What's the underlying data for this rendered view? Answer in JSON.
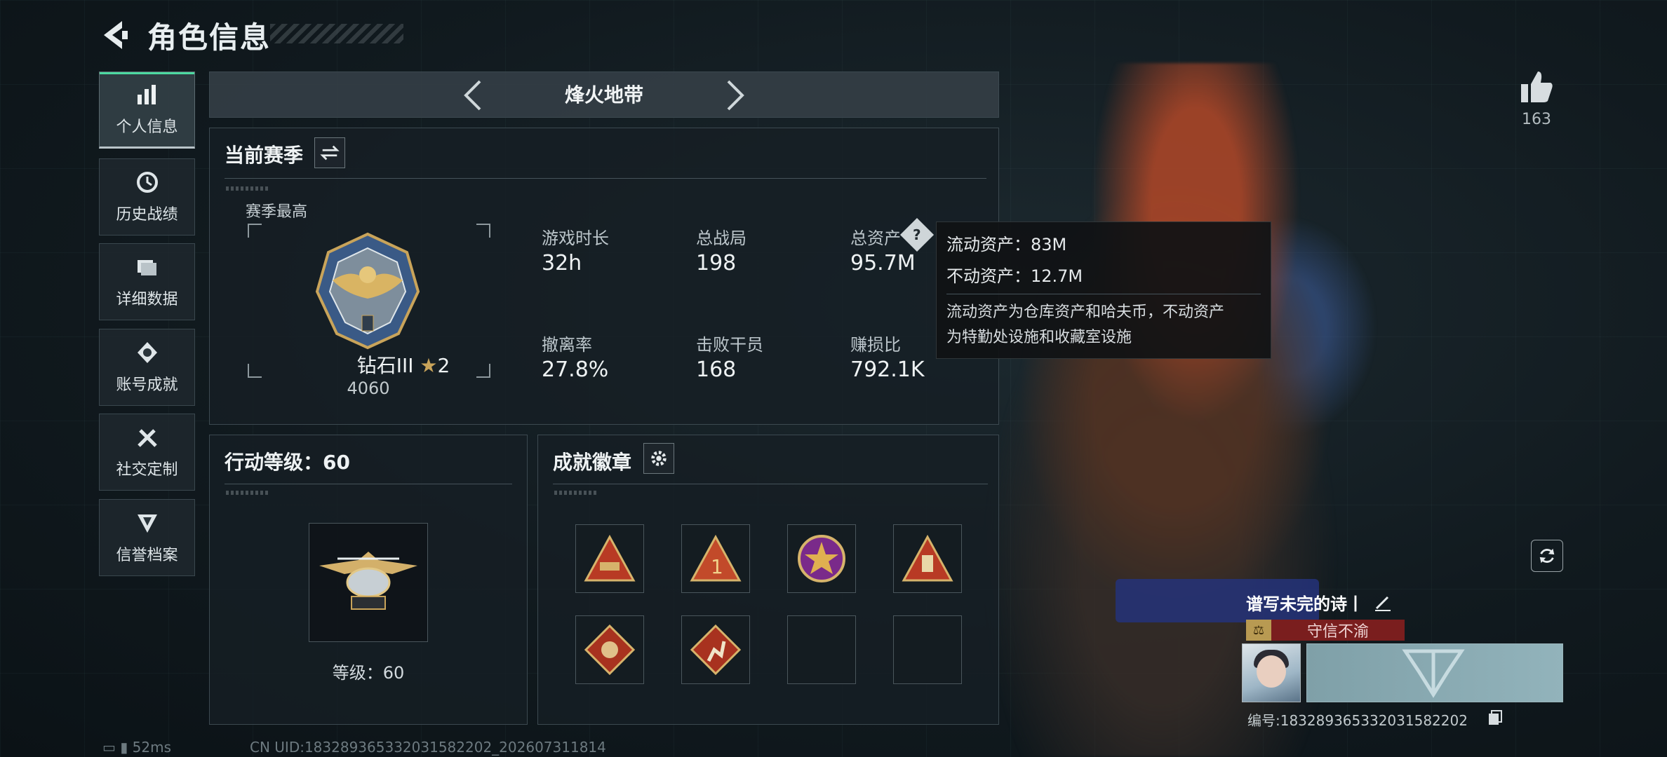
{
  "header": {
    "title": "角色信息"
  },
  "sidebar": {
    "items": [
      {
        "label": "个人信息",
        "icon": "bar-chart-icon",
        "active": true
      },
      {
        "label": "历史战绩",
        "icon": "clock-history-icon",
        "active": false
      },
      {
        "label": "详细数据",
        "icon": "folder-icon",
        "active": false
      },
      {
        "label": "账号成就",
        "icon": "achievement-icon",
        "active": false
      },
      {
        "label": "社交定制",
        "icon": "tools-icon",
        "active": false
      },
      {
        "label": "信誉档案",
        "icon": "reputation-icon",
        "active": false
      }
    ]
  },
  "mode": {
    "title": "烽火地带"
  },
  "season": {
    "title": "当前赛季",
    "best_label": "赛季最高",
    "rank_name": "钻石III",
    "rank_stars": "2",
    "rank_points": "4060",
    "stats": [
      {
        "label": "游戏时长",
        "value": "32h"
      },
      {
        "label": "总战局",
        "value": "198"
      },
      {
        "label": "总资产",
        "value": "95.7M"
      },
      {
        "label": "撤离率",
        "value": "27.8%"
      },
      {
        "label": "击败干员",
        "value": "168"
      },
      {
        "label": "赚损比",
        "value": "792.1K"
      }
    ]
  },
  "tooltip": {
    "liquid": "流动资产：83M",
    "fixed": "不动资产：12.7M",
    "desc_line1": "流动资产为仓库资产和哈夫币，不动资产",
    "desc_line2": "为特勤处设施和收藏室设施"
  },
  "action_level": {
    "title": "行动等级：60",
    "level_text": "等级：60"
  },
  "badges": {
    "title": "成就徽章",
    "slots": [
      "camel-badge-icon",
      "rank-one-badge-icon",
      "star-shield-badge-icon",
      "rock-hand-badge-icon",
      "dragon-badge-icon",
      "runner-badge-icon",
      "",
      ""
    ]
  },
  "profile": {
    "likes": "163",
    "name": "谱写未完的诗丨",
    "honor": "守信不渝",
    "id_text": "编号:18328936533203158220​2"
  },
  "footer": {
    "ping": "52ms",
    "uid": "CN UID:18328936533203158220​2_202607311814"
  },
  "colors": {
    "accent": "#4cd9a0",
    "honor_red": "#7a1e1e",
    "gold": "#c9a45a"
  }
}
